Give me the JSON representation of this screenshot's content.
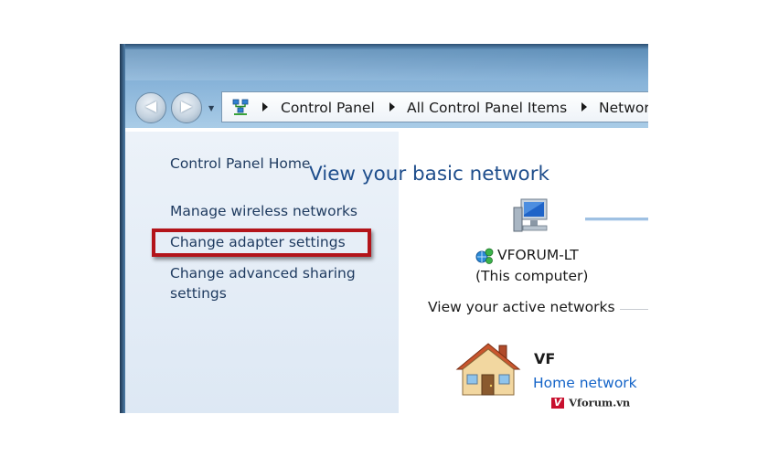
{
  "navigation": {
    "back_glyph": "◀",
    "forward_glyph": "▶",
    "history_glyph": "▼",
    "address_icon": "network-icon",
    "breadcrumbs": [
      "Control Panel",
      "All Control Panel Items",
      "Network"
    ]
  },
  "sidebar": {
    "home_link": "Control Panel Home",
    "links": [
      "Manage wireless networks",
      "Change adapter settings",
      "Change advanced sharing",
      "settings"
    ],
    "highlight_color": "#b3141a"
  },
  "main": {
    "heading": "View your basic network",
    "computer": {
      "icon": "monitor-icon",
      "name": "VFORUM-LT",
      "subtitle": "(This computer)"
    },
    "active_networks": {
      "title": "View your active networks",
      "network_icon": "house-icon",
      "network_name": "VF",
      "network_type": "Home network"
    }
  },
  "watermark": {
    "logo_letter": "V",
    "text": "Vforum.vn"
  },
  "colors": {
    "heading": "#1f4e8c",
    "link": "#1e3a5f",
    "network_type": "#1464c8"
  }
}
